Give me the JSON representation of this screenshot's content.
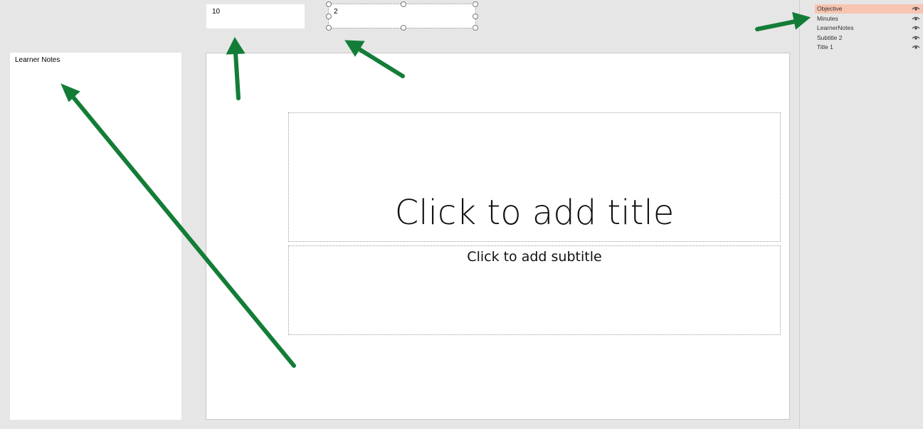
{
  "learner_notes": {
    "label": "Learner Notes"
  },
  "minutes_box": {
    "value": "10"
  },
  "objective_box": {
    "value": "2"
  },
  "slide": {
    "title_placeholder": "Click to add title",
    "subtitle_placeholder": "Click to add subtitle"
  },
  "selection_pane": {
    "items": [
      {
        "label": "Objective",
        "selected": true
      },
      {
        "label": "Minutes",
        "selected": false
      },
      {
        "label": "LearnerNotes",
        "selected": false
      },
      {
        "label": "Subtitle 2",
        "selected": false
      },
      {
        "label": "Title 1",
        "selected": false
      }
    ]
  },
  "colors": {
    "arrow": "#137d37",
    "selected_item": "#f8c5b1",
    "background": "#e6e6e6"
  }
}
